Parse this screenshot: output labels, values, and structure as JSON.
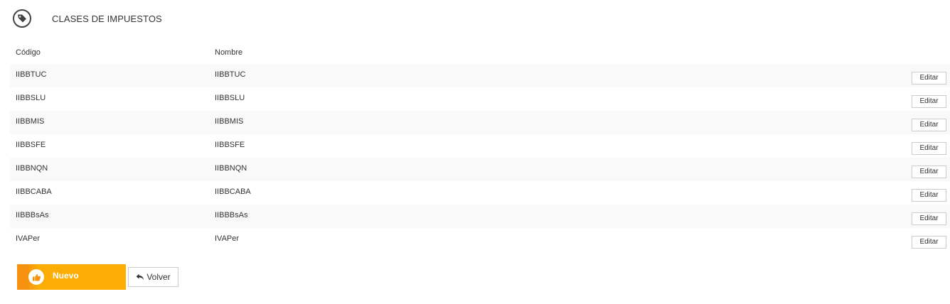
{
  "header": {
    "title": "CLASES DE IMPUESTOS",
    "icon": "tag-icon"
  },
  "table": {
    "columns": [
      "Código",
      "Nombre"
    ],
    "rows": [
      {
        "code": "IIBBTUC",
        "name": "IIBBTUC",
        "action": "Editar"
      },
      {
        "code": "IIBBSLU",
        "name": "IIBBSLU",
        "action": "Editar"
      },
      {
        "code": "IIBBMIS",
        "name": "IIBBMIS",
        "action": "Editar"
      },
      {
        "code": "IIBBSFE",
        "name": "IIBBSFE",
        "action": "Editar"
      },
      {
        "code": "IIBBNQN",
        "name": "IIBBNQN",
        "action": "Editar"
      },
      {
        "code": "IIBBCABA",
        "name": "IIBBCABA",
        "action": "Editar"
      },
      {
        "code": "IIBBBsAs",
        "name": "IIBBBsAs",
        "action": "Editar"
      },
      {
        "code": "IVAPer",
        "name": "IVAPer",
        "action": "Editar"
      }
    ]
  },
  "actions": {
    "new_label": "Nuevo",
    "new_icon": "thumbs-up-icon",
    "back_label": "Volver",
    "back_icon": "reply-arrow-icon"
  },
  "colors": {
    "accent": "#fbad06",
    "accent_dark": "#f6920f",
    "row_stripe": "#f9f9f9"
  }
}
